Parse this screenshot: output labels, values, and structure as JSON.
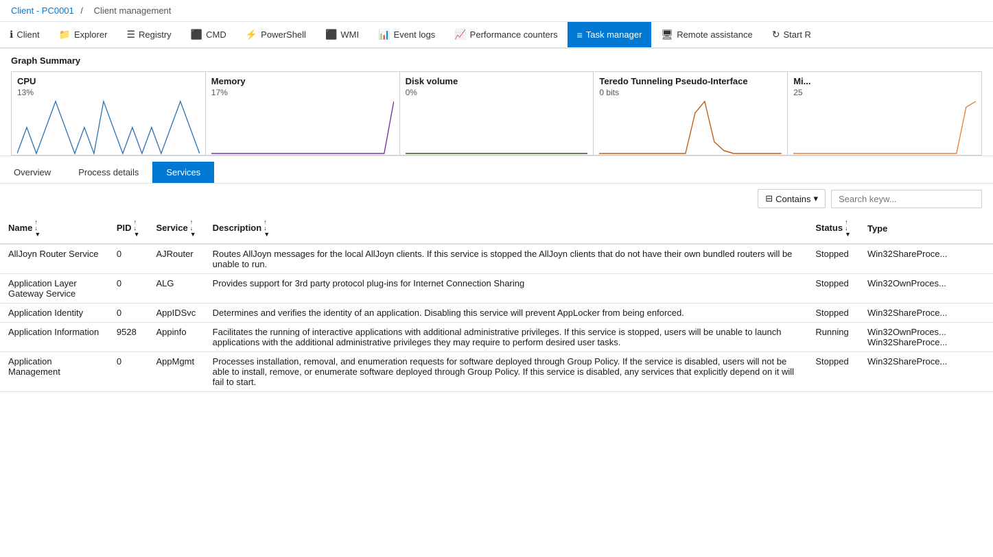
{
  "breadcrumb": {
    "link_text": "Client - PC0001",
    "separator": "/",
    "current": "Client management"
  },
  "navbar": {
    "items": [
      {
        "id": "client",
        "label": "Client",
        "icon": "ℹ",
        "active": false
      },
      {
        "id": "explorer",
        "label": "Explorer",
        "icon": "📁",
        "active": false
      },
      {
        "id": "registry",
        "label": "Registry",
        "icon": "☰",
        "active": false
      },
      {
        "id": "cmd",
        "label": "CMD",
        "icon": "⬛",
        "active": false
      },
      {
        "id": "powershell",
        "label": "PowerShell",
        "icon": "⚡",
        "active": false
      },
      {
        "id": "wmi",
        "label": "WMI",
        "icon": "⬛",
        "active": false
      },
      {
        "id": "event-logs",
        "label": "Event logs",
        "icon": "📊",
        "active": false
      },
      {
        "id": "performance-counters",
        "label": "Performance counters",
        "icon": "📈",
        "active": false
      },
      {
        "id": "task-manager",
        "label": "Task manager",
        "icon": "≡",
        "active": true
      },
      {
        "id": "remote-assistance",
        "label": "Remote assistance",
        "icon": "🖥",
        "active": false
      },
      {
        "id": "start-r",
        "label": "Start R",
        "icon": "↻",
        "active": false
      }
    ]
  },
  "graph_summary": {
    "title": "Graph Summary",
    "panels": [
      {
        "label": "CPU",
        "value": "13%",
        "color": "#2e75b6"
      },
      {
        "label": "Memory",
        "value": "17%",
        "color": "#7030a0"
      },
      {
        "label": "Disk volume",
        "value": "0%",
        "color": "#375623"
      },
      {
        "label": "Teredo Tunneling Pseudo-Interface",
        "value": "0 bits",
        "color": "#c55a11"
      },
      {
        "label": "Mi...",
        "value": "25",
        "color": "#ed7d31"
      }
    ]
  },
  "tabs": {
    "items": [
      {
        "id": "overview",
        "label": "Overview",
        "active": false
      },
      {
        "id": "process-details",
        "label": "Process details",
        "active": false
      },
      {
        "id": "services",
        "label": "Services",
        "active": true
      }
    ]
  },
  "toolbar": {
    "filter_label": "Contains",
    "search_placeholder": "Search keyw..."
  },
  "table": {
    "headers": [
      {
        "id": "name",
        "label": "Name",
        "sortable": true
      },
      {
        "id": "pid",
        "label": "PID",
        "sortable": true
      },
      {
        "id": "service",
        "label": "Service",
        "sortable": true
      },
      {
        "id": "description",
        "label": "Description",
        "sortable": true
      },
      {
        "id": "status",
        "label": "Status",
        "sortable": true
      },
      {
        "id": "type",
        "label": "Type",
        "sortable": false
      }
    ],
    "rows": [
      {
        "name": "AllJoyn Router Service",
        "pid": "0",
        "service": "AJRouter",
        "description": "Routes AllJoyn messages for the local AllJoyn clients. If this service is stopped the AllJoyn clients that do not have their own bundled routers will be unable to run.",
        "status": "Stopped",
        "type": "Win32ShareProce..."
      },
      {
        "name": "Application Layer Gateway Service",
        "pid": "0",
        "service": "ALG",
        "description": "Provides support for 3rd party protocol plug-ins for Internet Connection Sharing",
        "status": "Stopped",
        "type": "Win32OwnProces..."
      },
      {
        "name": "Application Identity",
        "pid": "0",
        "service": "AppIDSvc",
        "description": "Determines and verifies the identity of an application. Disabling this service will prevent AppLocker from being enforced.",
        "status": "Stopped",
        "type": "Win32ShareProce..."
      },
      {
        "name": "Application Information",
        "pid": "9528",
        "service": "Appinfo",
        "description": "Facilitates the running of interactive applications with additional administrative privileges. If this service is stopped, users will be unable to launch applications with the additional administrative privileges they may require to perform desired user tasks.",
        "status": "Running",
        "type": "Win32OwnProces... Win32ShareProce..."
      },
      {
        "name": "Application Management",
        "pid": "0",
        "service": "AppMgmt",
        "description": "Processes installation, removal, and enumeration requests for software deployed through Group Policy. If the service is disabled, users will not be able to install, remove, or enumerate software deployed through Group Policy. If this service is disabled, any services that explicitly depend on it will fail to start.",
        "status": "Stopped",
        "type": "Win32ShareProce..."
      }
    ]
  }
}
